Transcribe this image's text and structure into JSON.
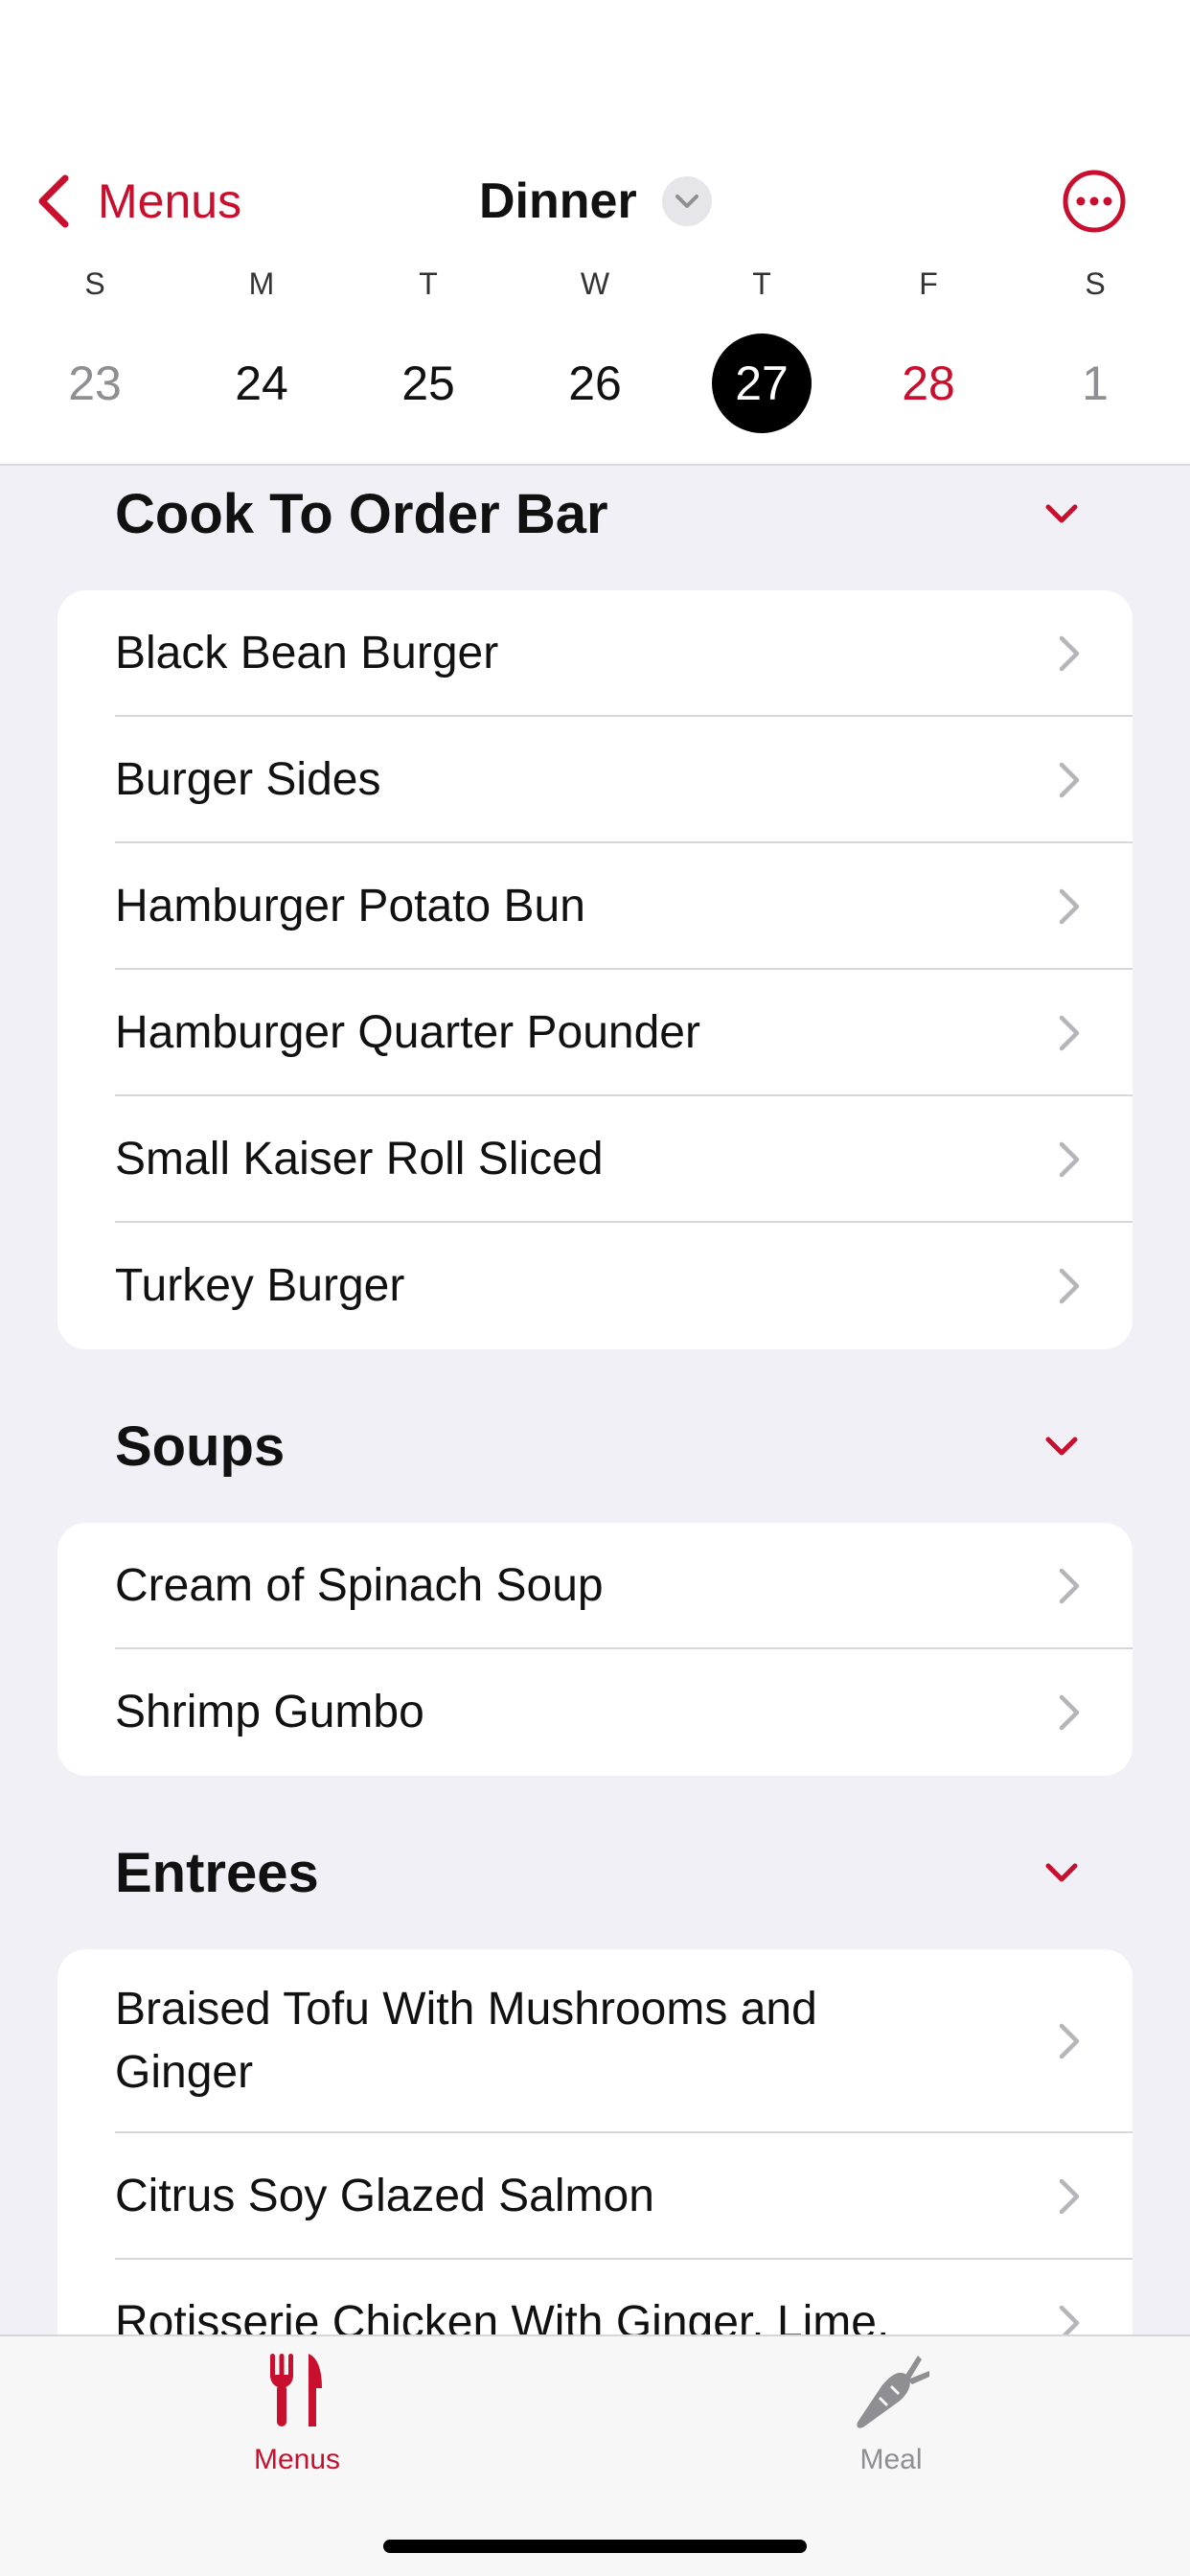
{
  "colors": {
    "accent": "#c8102e",
    "selected_day_bg": "#000000",
    "muted_text": "#8e8e93",
    "list_background": "#f0f0f6"
  },
  "nav": {
    "back_label": "Menus",
    "title": "Dinner",
    "back_icon": "chevron-left-icon",
    "title_icon": "chevron-down-icon",
    "more_icon": "ellipsis-circle-icon"
  },
  "week": [
    {
      "dow": "S",
      "date": "23",
      "state": "muted"
    },
    {
      "dow": "M",
      "date": "24",
      "state": "normal"
    },
    {
      "dow": "T",
      "date": "25",
      "state": "normal"
    },
    {
      "dow": "W",
      "date": "26",
      "state": "normal"
    },
    {
      "dow": "T",
      "date": "27",
      "state": "selected"
    },
    {
      "dow": "F",
      "date": "28",
      "state": "accent"
    },
    {
      "dow": "S",
      "date": "1",
      "state": "muted"
    }
  ],
  "sections": [
    {
      "title": "Cook To Order Bar",
      "items": [
        "Black Bean Burger",
        "Burger Sides",
        "Hamburger Potato Bun",
        "Hamburger Quarter Pounder",
        "Small Kaiser Roll Sliced",
        "Turkey Burger"
      ]
    },
    {
      "title": "Soups",
      "items": [
        "Cream of Spinach Soup",
        "Shrimp Gumbo"
      ]
    },
    {
      "title": "Entrees",
      "items": [
        "Braised Tofu With Mushrooms and Ginger",
        "Citrus Soy Glazed Salmon",
        "Rotisserie Chicken With Ginger, Lime,"
      ]
    }
  ],
  "tabs": [
    {
      "label": "Menus",
      "icon": "fork-knife-icon",
      "active": true
    },
    {
      "label": "Meal",
      "icon": "carrot-icon",
      "active": false
    }
  ]
}
